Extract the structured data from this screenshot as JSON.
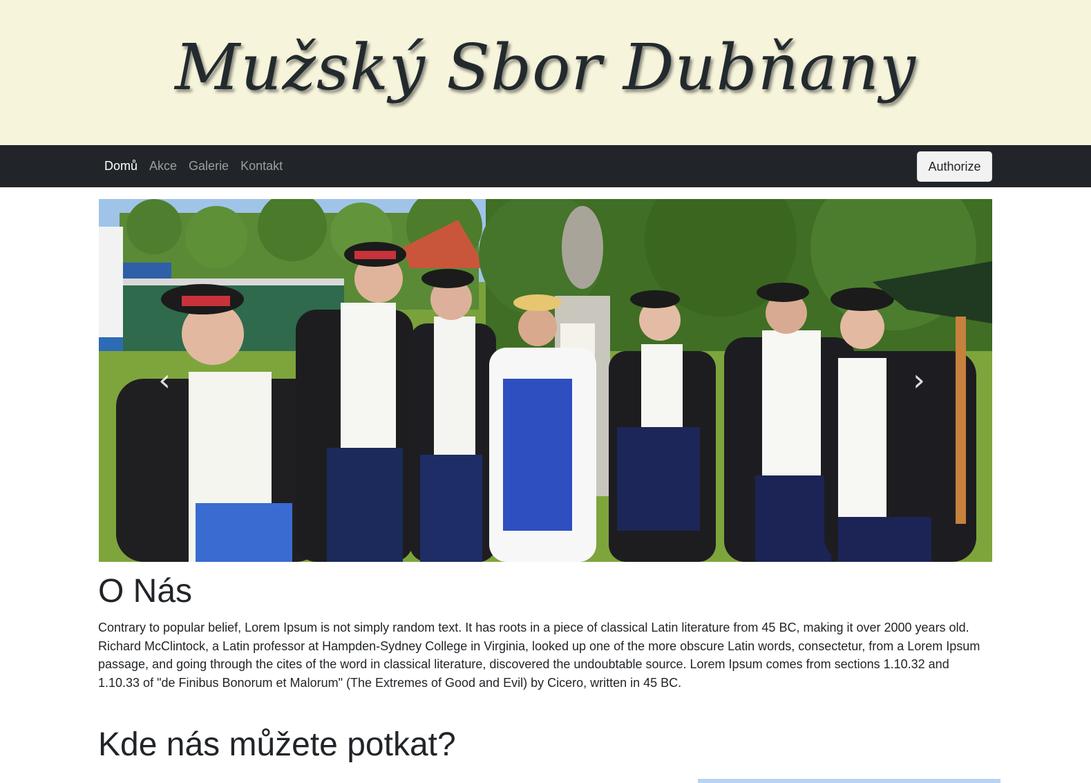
{
  "header": {
    "title": "Mužský Sbor Dubňany"
  },
  "nav": {
    "items": [
      {
        "label": "Domů",
        "active": true
      },
      {
        "label": "Akce",
        "active": false
      },
      {
        "label": "Galerie",
        "active": false
      },
      {
        "label": "Kontakt",
        "active": false
      }
    ],
    "authorize_label": "Authorize"
  },
  "carousel": {
    "prev_icon": "chevron-left-icon",
    "next_icon": "chevron-right-icon"
  },
  "about": {
    "title": "O Nás",
    "text": "Contrary to popular belief, Lorem Ipsum is not simply random text. It has roots in a piece of classical Latin literature from 45 BC, making it over 2000 years old. Richard McClintock, a Latin professor at Hampden-Sydney College in Virginia, looked up one of the more obscure Latin words, consectetur, from a Lorem Ipsum passage, and going through the cites of the word in classical literature, discovered the undoubtable source. Lorem Ipsum comes from sections 1.10.32 and 1.10.33 of \"de Finibus Bonorum et Malorum\" (The Extremes of Good and Evil) by Cicero, written in 45 BC."
  },
  "meet": {
    "title": "Kde nás můžete potkat?"
  },
  "colors": {
    "banner_bg": "#f7f4dc",
    "navbar_bg": "#212529",
    "accent_box": "#b9d3f3"
  }
}
